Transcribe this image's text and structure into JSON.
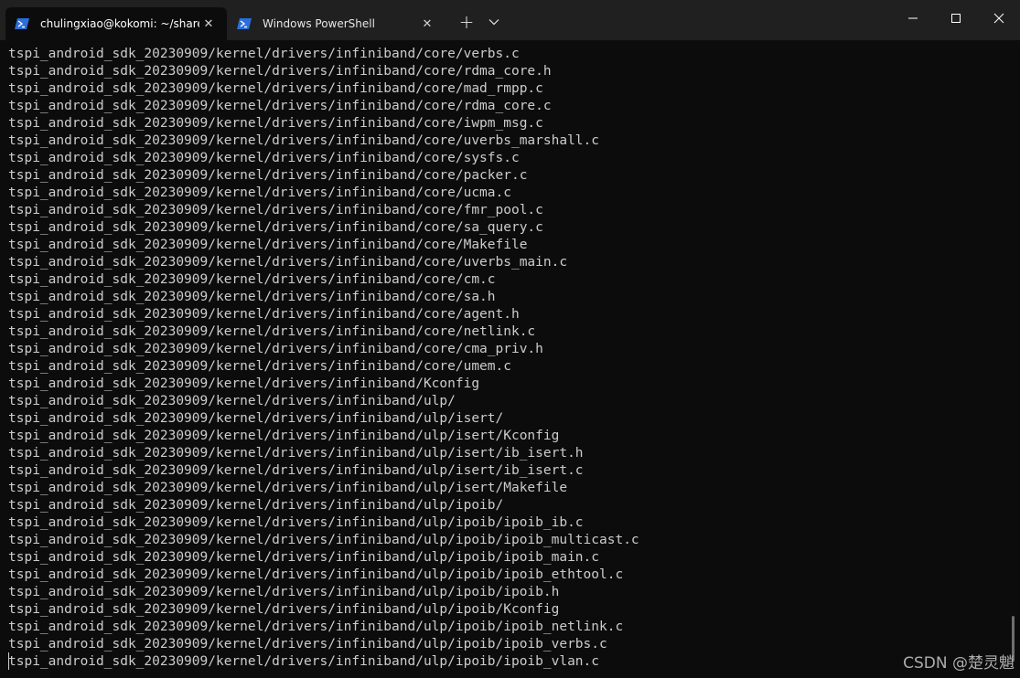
{
  "tabs": [
    {
      "label": "chulingxiao@kokomi: ~/share",
      "icon": "powershell-icon",
      "active": true
    },
    {
      "label": "Windows PowerShell",
      "icon": "powershell-icon",
      "active": false
    }
  ],
  "toolbar": {
    "new_tab": "+",
    "dropdown": "⌄"
  },
  "window_controls": {
    "minimize": "minimize-icon",
    "maximize": "maximize-icon",
    "close": "close-icon"
  },
  "terminal": {
    "lines": [
      "tspi_android_sdk_20230909/kernel/drivers/infiniband/core/verbs.c",
      "tspi_android_sdk_20230909/kernel/drivers/infiniband/core/rdma_core.h",
      "tspi_android_sdk_20230909/kernel/drivers/infiniband/core/mad_rmpp.c",
      "tspi_android_sdk_20230909/kernel/drivers/infiniband/core/rdma_core.c",
      "tspi_android_sdk_20230909/kernel/drivers/infiniband/core/iwpm_msg.c",
      "tspi_android_sdk_20230909/kernel/drivers/infiniband/core/uverbs_marshall.c",
      "tspi_android_sdk_20230909/kernel/drivers/infiniband/core/sysfs.c",
      "tspi_android_sdk_20230909/kernel/drivers/infiniband/core/packer.c",
      "tspi_android_sdk_20230909/kernel/drivers/infiniband/core/ucma.c",
      "tspi_android_sdk_20230909/kernel/drivers/infiniband/core/fmr_pool.c",
      "tspi_android_sdk_20230909/kernel/drivers/infiniband/core/sa_query.c",
      "tspi_android_sdk_20230909/kernel/drivers/infiniband/core/Makefile",
      "tspi_android_sdk_20230909/kernel/drivers/infiniband/core/uverbs_main.c",
      "tspi_android_sdk_20230909/kernel/drivers/infiniband/core/cm.c",
      "tspi_android_sdk_20230909/kernel/drivers/infiniband/core/sa.h",
      "tspi_android_sdk_20230909/kernel/drivers/infiniband/core/agent.h",
      "tspi_android_sdk_20230909/kernel/drivers/infiniband/core/netlink.c",
      "tspi_android_sdk_20230909/kernel/drivers/infiniband/core/cma_priv.h",
      "tspi_android_sdk_20230909/kernel/drivers/infiniband/core/umem.c",
      "tspi_android_sdk_20230909/kernel/drivers/infiniband/Kconfig",
      "tspi_android_sdk_20230909/kernel/drivers/infiniband/ulp/",
      "tspi_android_sdk_20230909/kernel/drivers/infiniband/ulp/isert/",
      "tspi_android_sdk_20230909/kernel/drivers/infiniband/ulp/isert/Kconfig",
      "tspi_android_sdk_20230909/kernel/drivers/infiniband/ulp/isert/ib_isert.h",
      "tspi_android_sdk_20230909/kernel/drivers/infiniband/ulp/isert/ib_isert.c",
      "tspi_android_sdk_20230909/kernel/drivers/infiniband/ulp/isert/Makefile",
      "tspi_android_sdk_20230909/kernel/drivers/infiniband/ulp/ipoib/",
      "tspi_android_sdk_20230909/kernel/drivers/infiniband/ulp/ipoib/ipoib_ib.c",
      "tspi_android_sdk_20230909/kernel/drivers/infiniband/ulp/ipoib/ipoib_multicast.c",
      "tspi_android_sdk_20230909/kernel/drivers/infiniband/ulp/ipoib/ipoib_main.c",
      "tspi_android_sdk_20230909/kernel/drivers/infiniband/ulp/ipoib/ipoib_ethtool.c",
      "tspi_android_sdk_20230909/kernel/drivers/infiniband/ulp/ipoib/ipoib.h",
      "tspi_android_sdk_20230909/kernel/drivers/infiniband/ulp/ipoib/Kconfig",
      "tspi_android_sdk_20230909/kernel/drivers/infiniband/ulp/ipoib/ipoib_netlink.c",
      "tspi_android_sdk_20230909/kernel/drivers/infiniband/ulp/ipoib/ipoib_verbs.c",
      "tspi_android_sdk_20230909/kernel/drivers/infiniband/ulp/ipoib/ipoib_vlan.c"
    ]
  },
  "watermark": "CSDN @楚灵魈",
  "colors": {
    "titlebar": "#202020",
    "terminal_bg": "#0c0c0c",
    "terminal_text": "#cccccc",
    "powershell_blue": "#2a6fdb"
  }
}
